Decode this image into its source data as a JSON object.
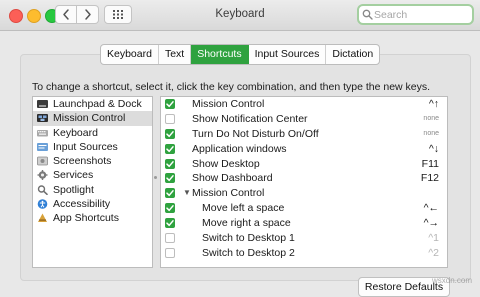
{
  "window": {
    "title": "Keyboard"
  },
  "search": {
    "placeholder": "Search",
    "value": ""
  },
  "tabs": [
    {
      "label": "Keyboard",
      "active": false
    },
    {
      "label": "Text",
      "active": false
    },
    {
      "label": "Shortcuts",
      "active": true
    },
    {
      "label": "Input Sources",
      "active": false
    },
    {
      "label": "Dictation",
      "active": false
    }
  ],
  "instructions": "To change a shortcut, select it, click the key combination, and then type the new keys.",
  "categories": [
    {
      "label": "Launchpad & Dock",
      "icon": "launchpad-icon",
      "color": "#3a3a3a"
    },
    {
      "label": "Mission Control",
      "icon": "mission-control-icon",
      "color": "#2c2c2c",
      "selected": true
    },
    {
      "label": "Keyboard",
      "icon": "keyboard-icon",
      "color": "#9a9a9a"
    },
    {
      "label": "Input Sources",
      "icon": "input-sources-icon",
      "color": "#6aa0d8"
    },
    {
      "label": "Screenshots",
      "icon": "screenshots-icon",
      "color": "#8b8b8b"
    },
    {
      "label": "Services",
      "icon": "gear-icon",
      "color": "#7a7a7a"
    },
    {
      "label": "Spotlight",
      "icon": "spotlight-icon",
      "color": "#6f6f6f"
    },
    {
      "label": "Accessibility",
      "icon": "accessibility-icon",
      "color": "#2f7fd6"
    },
    {
      "label": "App Shortcuts",
      "icon": "app-shortcuts-icon",
      "color": "#d8a23a"
    }
  ],
  "shortcuts": [
    {
      "label": "Mission Control",
      "checked": true,
      "key": "^↑"
    },
    {
      "label": "Show Notification Center",
      "checked": false,
      "key": "none"
    },
    {
      "label": "Turn Do Not Disturb On/Off",
      "checked": true,
      "key": "none"
    },
    {
      "label": "Application windows",
      "checked": true,
      "key": "^↓"
    },
    {
      "label": "Show Desktop",
      "checked": true,
      "key": "F11"
    },
    {
      "label": "Show Dashboard",
      "checked": true,
      "key": "F12"
    },
    {
      "label": "Mission Control",
      "checked": true,
      "key": "",
      "group": true
    },
    {
      "label": "Move left a space",
      "checked": true,
      "key": "^←",
      "child": true
    },
    {
      "label": "Move right a space",
      "checked": true,
      "key": "^→",
      "child": true
    },
    {
      "label": "Switch to Desktop 1",
      "checked": false,
      "key": "^1",
      "child": true
    },
    {
      "label": "Switch to Desktop 2",
      "checked": false,
      "key": "^2",
      "child": true
    }
  ],
  "restore_button": "Restore Defaults",
  "watermark": "wsxdn.com",
  "colors": {
    "accent": "#2fa23f",
    "search_focus": "#a4cfa0"
  }
}
